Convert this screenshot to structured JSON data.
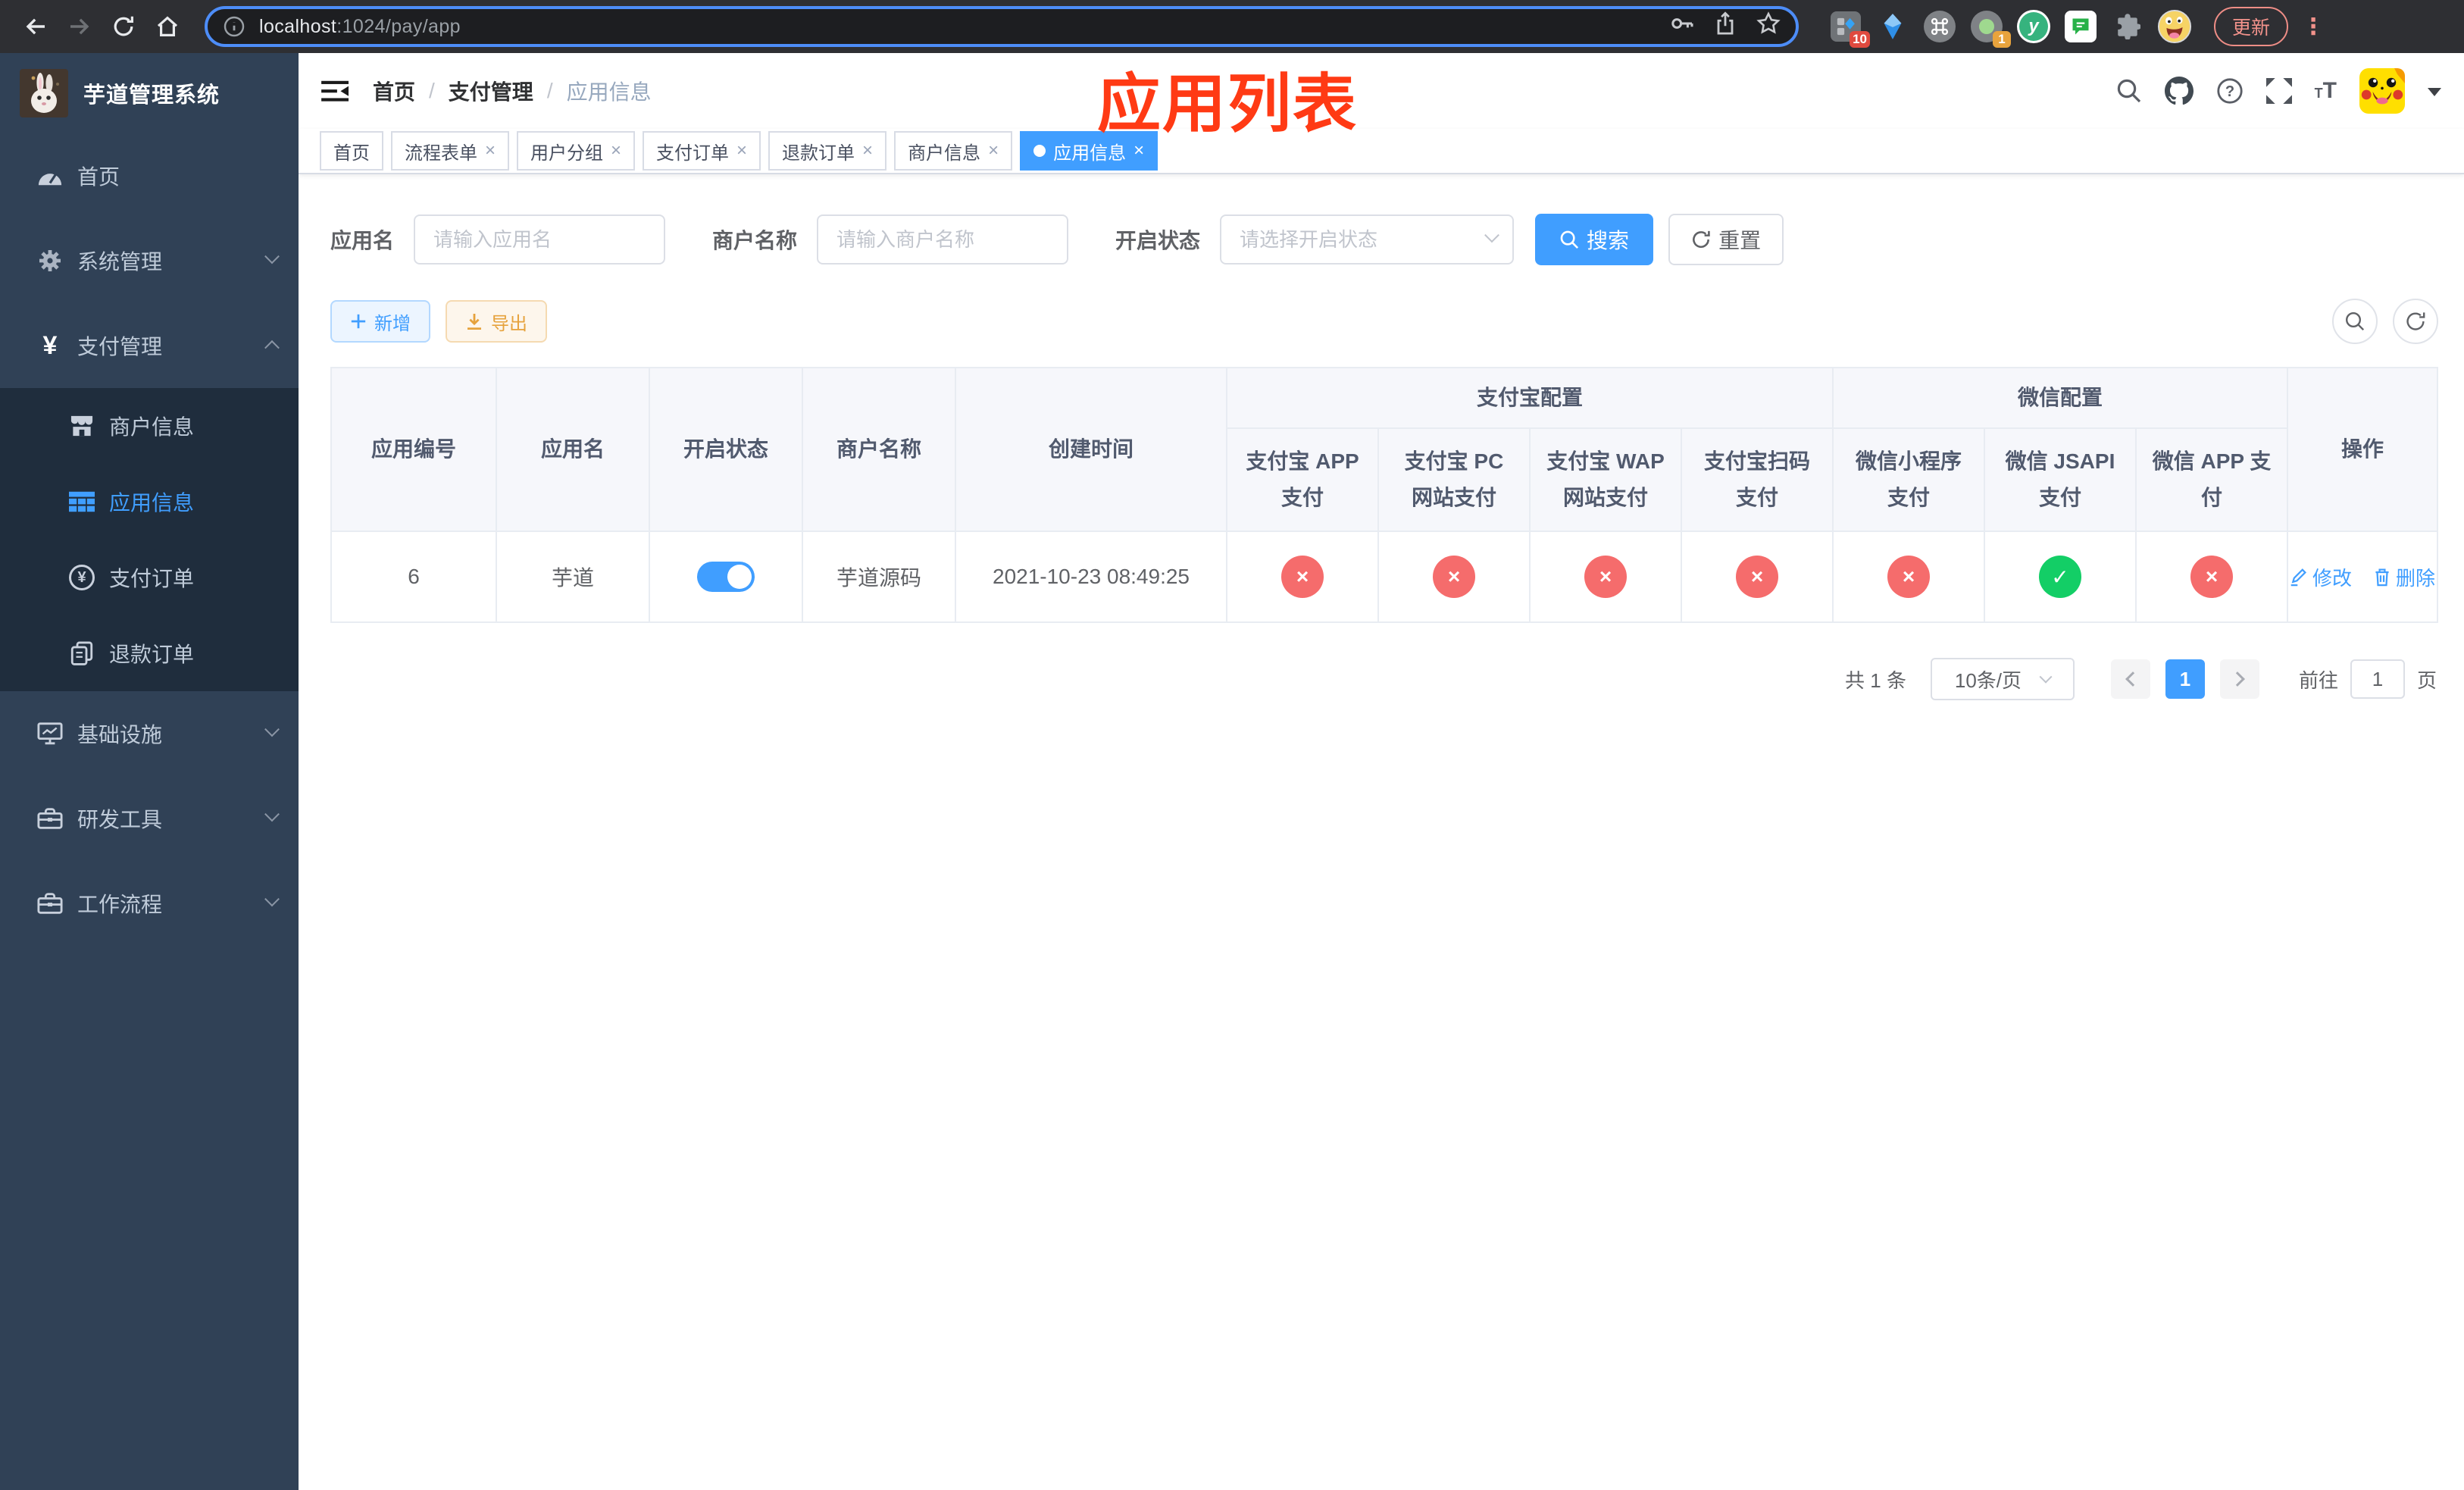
{
  "colors": {
    "accent": "#409eff",
    "danger": "#f56c6c",
    "success": "#13ce66",
    "warning": "#e6a23c",
    "annotation_red": "#ff3a14",
    "sidebar_bg": "#304156",
    "submenu_bg": "#1f2d3d"
  },
  "browser": {
    "url": {
      "host": "localhost",
      "rest": ":1024/pay/app"
    },
    "update_label": "更新",
    "ext_badges": {
      "tag_assistant": "10",
      "session": "1"
    }
  },
  "sidebar": {
    "title": "芋道管理系统",
    "menu": [
      {
        "label": "首页",
        "icon": "dashboard-icon"
      },
      {
        "label": "系统管理",
        "icon": "gear-icon"
      },
      {
        "label": "支付管理",
        "icon": "yen-icon"
      },
      {
        "label": "基础设施",
        "icon": "monitor-icon"
      },
      {
        "label": "研发工具",
        "icon": "toolbox-icon"
      },
      {
        "label": "工作流程",
        "icon": "briefcase-icon"
      }
    ],
    "submenu": [
      {
        "label": "商户信息",
        "icon": "shop-icon",
        "active": false
      },
      {
        "label": "应用信息",
        "icon": "grid-icon",
        "active": true
      },
      {
        "label": "支付订单",
        "icon": "coin-icon",
        "active": false
      },
      {
        "label": "退款订单",
        "icon": "copy-icon",
        "active": false
      }
    ]
  },
  "header": {
    "breadcrumb": [
      "首页",
      "支付管理",
      "应用信息"
    ],
    "annotation": "应用列表"
  },
  "tabs": [
    {
      "label": "首页",
      "active": false,
      "closable": false
    },
    {
      "label": "流程表单",
      "active": false,
      "closable": true
    },
    {
      "label": "用户分组",
      "active": false,
      "closable": true
    },
    {
      "label": "支付订单",
      "active": false,
      "closable": true
    },
    {
      "label": "退款订单",
      "active": false,
      "closable": true
    },
    {
      "label": "商户信息",
      "active": false,
      "closable": true
    },
    {
      "label": "应用信息",
      "active": true,
      "closable": true
    }
  ],
  "filters": {
    "app_name": {
      "label": "应用名",
      "placeholder": "请输入应用名",
      "value": ""
    },
    "merchant_name": {
      "label": "商户名称",
      "placeholder": "请输入商户名称",
      "value": ""
    },
    "status": {
      "label": "开启状态",
      "placeholder": "请选择开启状态",
      "value": ""
    },
    "search_label": "搜索",
    "reset_label": "重置"
  },
  "toolbar": {
    "add_label": "新增",
    "export_label": "导出"
  },
  "table": {
    "groups": {
      "alipay": "支付宝配置",
      "wechat": "微信配置"
    },
    "columns": {
      "id": "应用编号",
      "name": "应用名",
      "status": "开启状态",
      "merchant": "商户名称",
      "created": "创建时间",
      "alipay_app": "支付宝 APP 支付",
      "alipay_pc": "支付宝 PC 网站支付",
      "alipay_wap": "支付宝 WAP 网站支付",
      "alipay_qr": "支付宝扫码支付",
      "wx_mini": "微信小程序支付",
      "wx_jsapi": "微信 JSAPI 支付",
      "wx_app": "微信 APP 支付",
      "actions": "操作"
    },
    "rows": [
      {
        "id": "6",
        "name": "芋道",
        "enabled": true,
        "merchant": "芋道源码",
        "created": "2021-10-23 08:49:25",
        "statuses": [
          false,
          false,
          false,
          false,
          false,
          true,
          false
        ],
        "edit_label": "修改",
        "delete_label": "删除"
      }
    ]
  },
  "pagination": {
    "total": "共 1 条",
    "page_size": "10条/页",
    "current_page": "1",
    "goto_label": "前往",
    "goto_value": "1",
    "page_unit": "页"
  }
}
